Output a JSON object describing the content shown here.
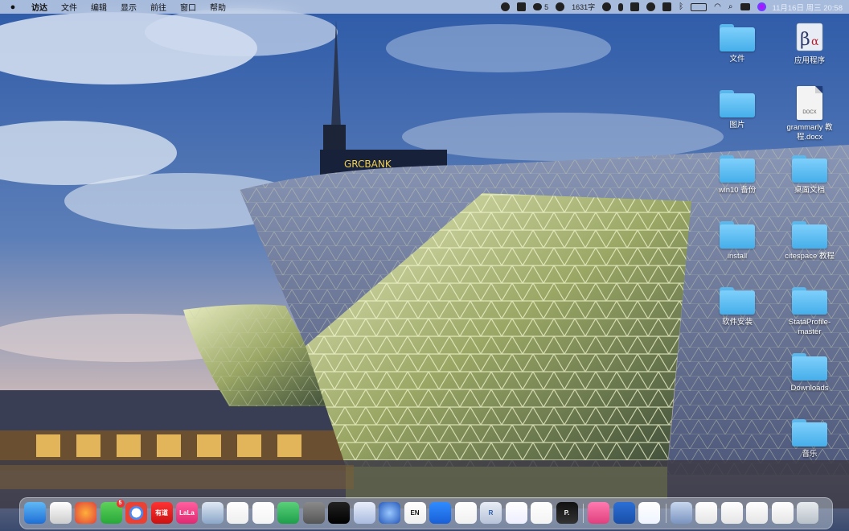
{
  "menubar": {
    "apple_icon": "apple-logo-icon",
    "items": [
      "访达",
      "文件",
      "编辑",
      "显示",
      "前往",
      "窗口",
      "帮助"
    ],
    "status": {
      "wechat_count": "5",
      "word_count": "1631字",
      "datetime": "11月16日 周三 20:58"
    }
  },
  "desktop": {
    "items": [
      {
        "label": "应用程序",
        "kind": "app"
      },
      {
        "label": "文件",
        "kind": "folder"
      },
      {
        "label": "grammarly 教程.docx",
        "kind": "docx",
        "ext": "DOCX"
      },
      {
        "label": "图片",
        "kind": "folder"
      },
      {
        "label": "win10 备份",
        "kind": "folder"
      },
      {
        "label": "桌面文档",
        "kind": "folder"
      },
      {
        "label": "install",
        "kind": "folder"
      },
      {
        "label": "citespace 教程",
        "kind": "folder"
      },
      {
        "label": "软件安装",
        "kind": "folder"
      },
      {
        "label": "StataProfile-master",
        "kind": "folder"
      },
      {
        "label": "Downloads",
        "kind": "folder"
      },
      {
        "label": "音乐",
        "kind": "folder"
      }
    ]
  },
  "wallpaper": {
    "sign_text": "广州农商银行 GRCBANK"
  },
  "dock": {
    "apps": [
      {
        "name": "finder-icon",
        "label": ""
      },
      {
        "name": "launchpad-icon",
        "label": ""
      },
      {
        "name": "firefox-icon",
        "label": ""
      },
      {
        "name": "wechat-icon",
        "label": "",
        "badge": "5"
      },
      {
        "name": "chrome-icon",
        "label": ""
      },
      {
        "name": "youdao-icon",
        "label": "有道"
      },
      {
        "name": "lala-icon",
        "label": "LaLa"
      },
      {
        "name": "preview-icon",
        "label": ""
      },
      {
        "name": "pages-icon",
        "label": ""
      },
      {
        "name": "wps-icon",
        "label": ""
      },
      {
        "name": "xmind-icon",
        "label": ""
      },
      {
        "name": "system-preferences-icon",
        "label": ""
      },
      {
        "name": "voice-memos-icon",
        "label": ""
      },
      {
        "name": "calendar-grid-icon",
        "label": ""
      },
      {
        "name": "network-icon",
        "label": ""
      },
      {
        "name": "en-icon",
        "label": "EN"
      },
      {
        "name": "lark-icon",
        "label": ""
      },
      {
        "name": "document-preview-icon",
        "label": ""
      },
      {
        "name": "r-language-icon",
        "label": "R"
      },
      {
        "name": "rstudio-icon",
        "label": ""
      },
      {
        "name": "nodes-icon",
        "label": ""
      },
      {
        "name": "parallels-icon",
        "label": "P."
      },
      {
        "name": "folder-pink-icon",
        "label": ""
      },
      {
        "name": "word-icon",
        "label": ""
      },
      {
        "name": "baidu-netdisk-icon",
        "label": ""
      },
      {
        "name": "clipboard-icon",
        "label": ""
      },
      {
        "name": "file-1-icon",
        "label": ""
      },
      {
        "name": "file-2-icon",
        "label": ""
      },
      {
        "name": "file-3-icon",
        "label": ""
      },
      {
        "name": "file-4-icon",
        "label": ""
      },
      {
        "name": "trash-icon",
        "label": ""
      }
    ]
  }
}
